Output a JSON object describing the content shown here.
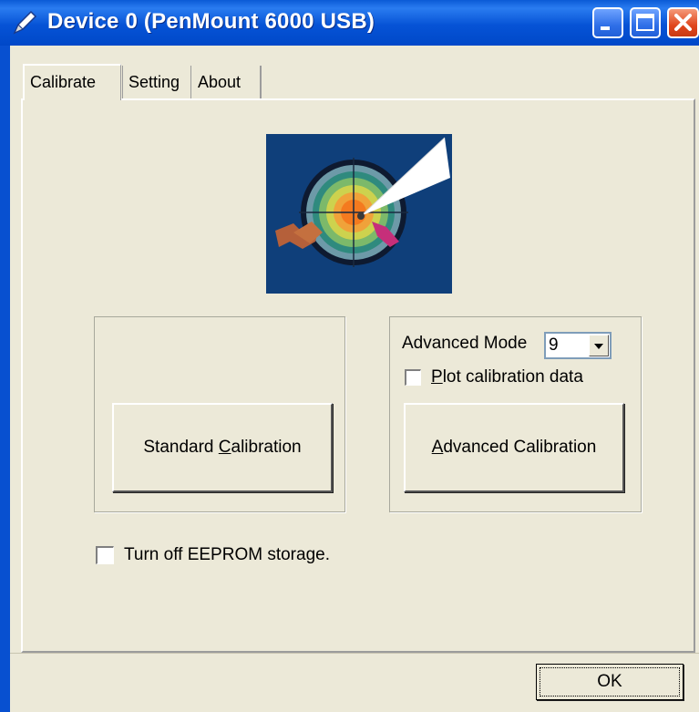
{
  "window": {
    "title": "Device 0 (PenMount 6000 USB)",
    "icons": {
      "title": "pen-icon",
      "minimize": "minimize-icon",
      "maximize": "maximize-icon",
      "close": "close-icon"
    }
  },
  "tabs": [
    {
      "label": "Calibrate",
      "active": true
    },
    {
      "label": "Setting",
      "active": false
    },
    {
      "label": "About",
      "active": false
    }
  ],
  "calibrate": {
    "graphic": "calibration-target-icon",
    "standard_button": {
      "pre": "Standard ",
      "key": "C",
      "post": "alibration"
    },
    "advanced_mode": {
      "label": "Advanced Mode",
      "value": "9"
    },
    "plot_data": {
      "key": "P",
      "post": "lot calibration data",
      "checked": false
    },
    "advanced_button": {
      "key": "A",
      "post": "dvanced Calibration"
    },
    "eeprom": {
      "label": "Turn off EEPROM storage.",
      "checked": false
    }
  },
  "footer": {
    "ok_label": "OK"
  },
  "colors": {
    "title_bar": "#0653d6",
    "dialog_bg": "#ece9d8",
    "close_button": "#e0461c"
  }
}
